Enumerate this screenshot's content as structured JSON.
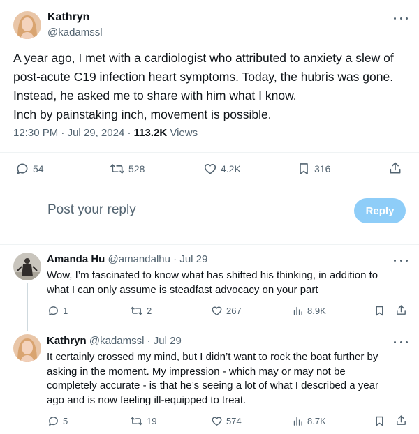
{
  "main_tweet": {
    "author_name": "Kathryn",
    "author_handle": "@kadamssl",
    "text_lines": [
      "A year ago, I met with a cardiologist who attributed to anxiety a slew of",
      "post-acute C19 infection heart symptoms. Today, the hubris was gone.",
      "Instead, he asked me to share with him what I know.",
      "Inch by painstaking inch, movement is possible."
    ],
    "time": "12:30 PM",
    "date": "Jul 29, 2024",
    "views_count": "113.2K",
    "views_label": "Views",
    "replies": "54",
    "retweets": "528",
    "likes": "4.2K",
    "bookmarks": "316"
  },
  "reply_box": {
    "placeholder": "Post your reply",
    "button_label": "Reply"
  },
  "replies": [
    {
      "name": "Amanda Hu",
      "handle": "@amandalhu",
      "date": "Jul 29",
      "text_lines": [
        "Wow, I’m fascinated to know what has shifted his thinking, in addition to",
        "what I can only assume is steadfast advocacy on your part"
      ],
      "replies": "1",
      "retweets": "2",
      "likes": "267",
      "views": "8.9K"
    },
    {
      "name": "Kathryn",
      "handle": "@kadamssl",
      "date": "Jul 29",
      "text_lines": [
        "It certainly crossed my mind, but I didn’t want to rock the boat further by",
        "asking in the moment. My impression - which may or may not be",
        "completely accurate - is that he’s seeing a lot of what I described a year",
        "ago and is now feeling ill-equipped to treat."
      ],
      "replies": "5",
      "retweets": "19",
      "likes": "574",
      "views": "8.7K"
    }
  ],
  "separator": "·",
  "icons": {
    "reply": "reply-icon",
    "retweet": "retweet-icon",
    "like": "heart-icon",
    "bookmark": "bookmark-icon",
    "share": "share-icon",
    "views": "views-chart-icon",
    "more": "more-icon"
  },
  "colors": {
    "text": "#0f1419",
    "secondary": "#536471",
    "reply_button": "#8ecdf8",
    "divider": "#eff3f4"
  }
}
